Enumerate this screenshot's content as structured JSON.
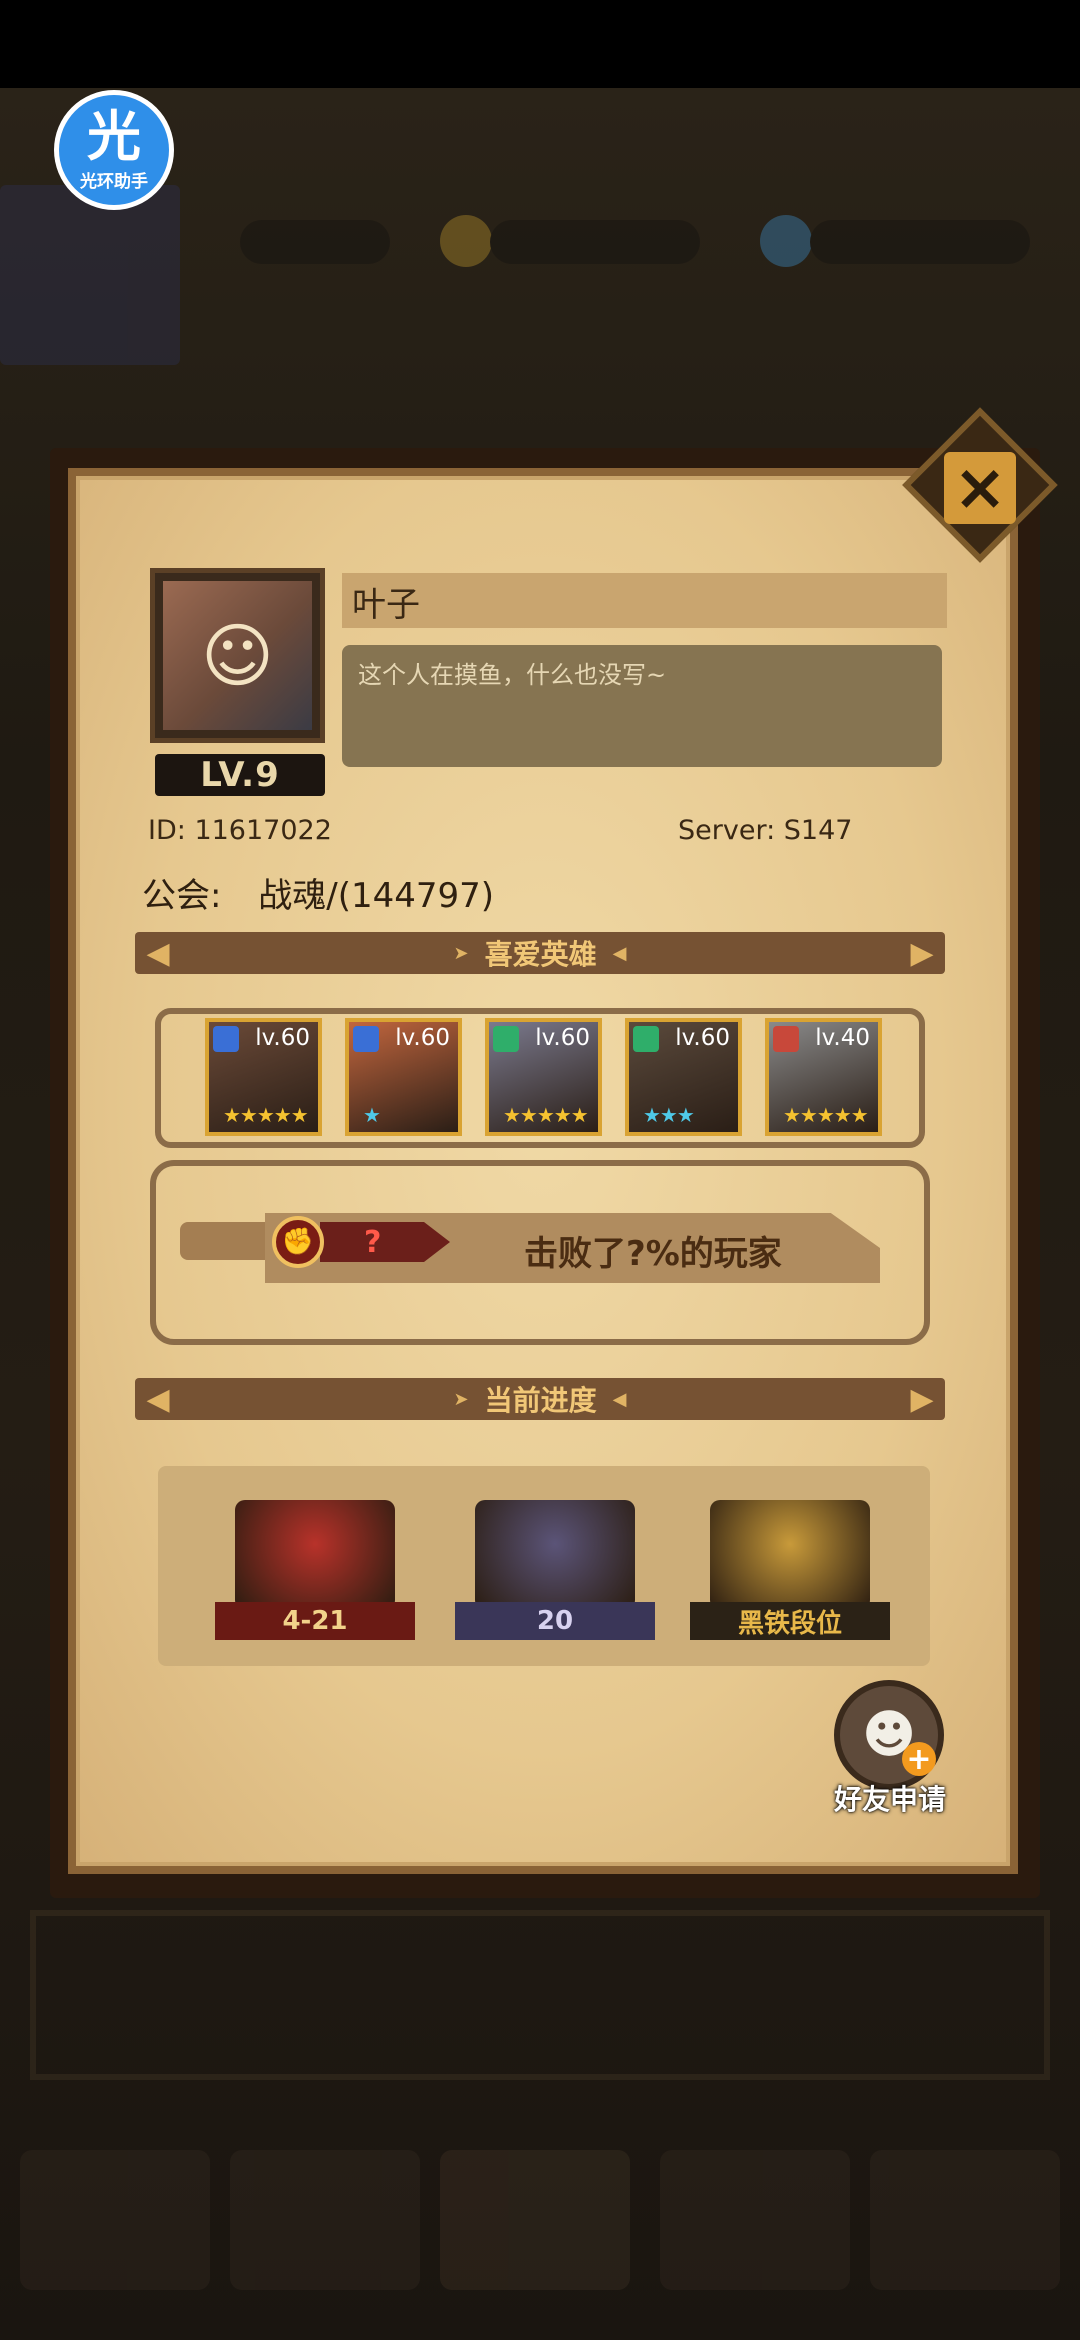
{
  "helper": {
    "glyph": "光",
    "label": "光环助手"
  },
  "profile": {
    "name": "叶子",
    "description": "这个人在摸鱼，什么也没写~",
    "level": "LV.9",
    "id_label": "ID:",
    "id_value": "11617022",
    "server_label": "Server:",
    "server_value": "S147",
    "guild_label": "公会:",
    "guild_value": "战魂/(144797)"
  },
  "sections": {
    "favorite_heroes": "喜爱英雄",
    "current_progress": "当前进度"
  },
  "heroes": [
    {
      "level": "lv.60",
      "stars": "★★★★★",
      "badge_color": "#3a6fd6",
      "star_color": "#f5c230",
      "tint": "#6b4a38"
    },
    {
      "level": "lv.60",
      "stars": "★",
      "badge_color": "#3a6fd6",
      "star_color": "#4fc9e8",
      "tint": "#c2663e"
    },
    {
      "level": "lv.60",
      "stars": "★★★★★",
      "badge_color": "#2fae6a",
      "star_color": "#f5c230",
      "tint": "#7b7a8e"
    },
    {
      "level": "lv.60",
      "stars": "★★★",
      "badge_color": "#2fae6a",
      "star_color": "#4fc9e8",
      "tint": "#5b4a3c"
    },
    {
      "level": "lv.40",
      "stars": "★★★★★",
      "badge_color": "#c8483a",
      "star_color": "#f5c230",
      "tint": "#8a8a8a"
    }
  ],
  "defeat": {
    "value": "?",
    "text": "击败了?%的玩家"
  },
  "progress": [
    {
      "label": "4-21",
      "color": "#b8322a",
      "ribbon": "#6a1a14",
      "text_color": "#f2d28a"
    },
    {
      "label": "20",
      "color": "#5b5478",
      "ribbon": "#3a3658",
      "text_color": "#d8d2f0"
    },
    {
      "label": "黑铁段位",
      "color": "#c89a3a",
      "ribbon": "#2b2216",
      "text_color": "#e8b84a"
    }
  ],
  "friend_request": {
    "label": "好友申请"
  },
  "colors": {
    "parchment": "#e6c88f",
    "section_bar": "#765233",
    "section_title": "#f1c777"
  }
}
